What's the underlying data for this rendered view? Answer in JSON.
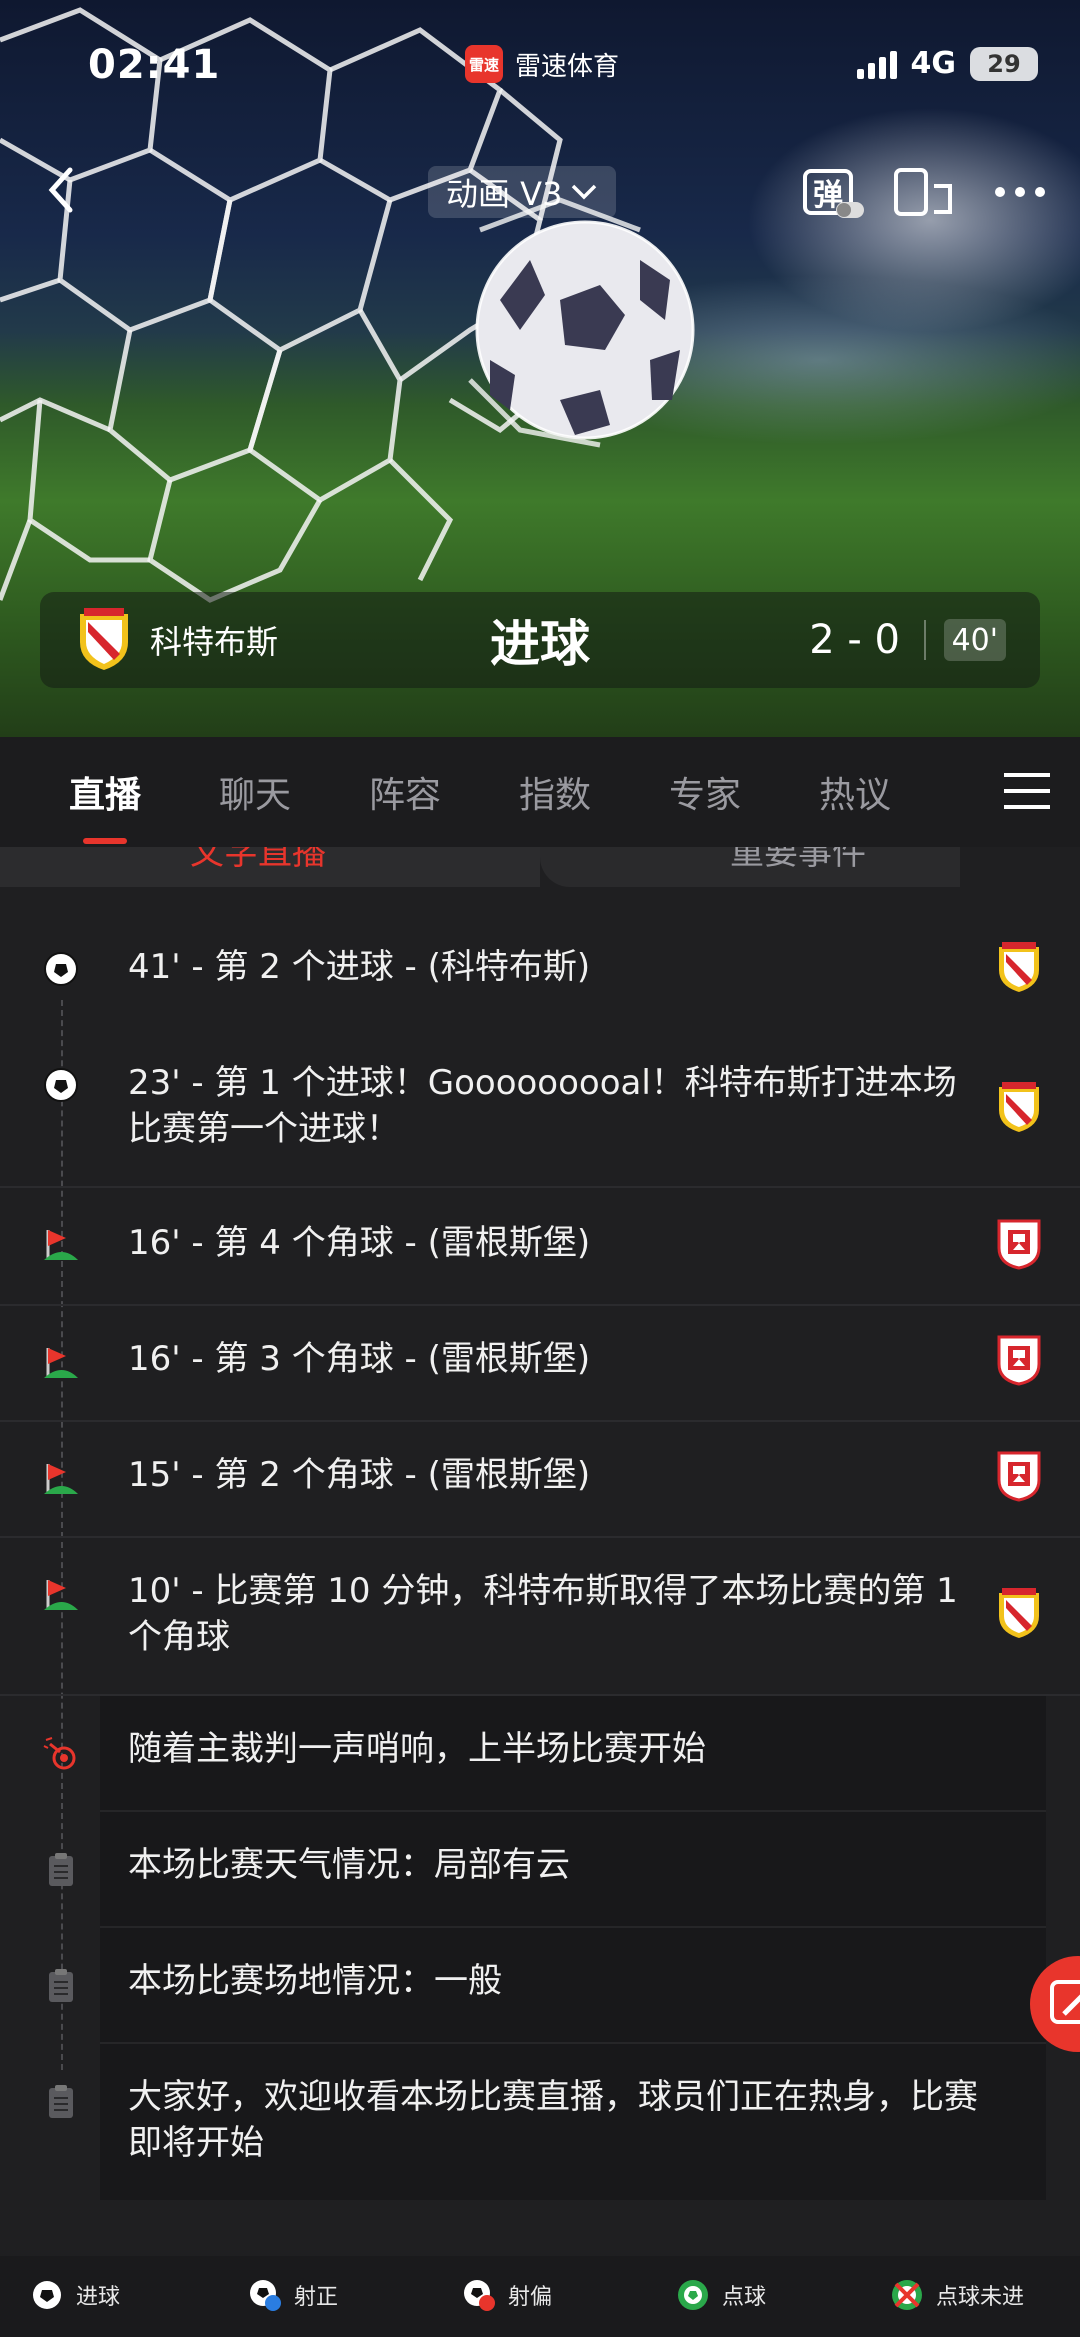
{
  "status_bar": {
    "time": "02:41",
    "app_name": "雷速体育",
    "app_logo_text": "雷速",
    "network": "4G",
    "battery": "29"
  },
  "header": {
    "animation_mode": "动画 V3",
    "danmaku_label": "弹"
  },
  "scoreboard": {
    "team": "科特布斯",
    "event": "进球",
    "score": "2 - 0",
    "minute": "40'"
  },
  "tabs": [
    {
      "label": "直播",
      "active": true
    },
    {
      "label": "聊天"
    },
    {
      "label": "阵容"
    },
    {
      "label": "指数"
    },
    {
      "label": "专家"
    },
    {
      "label": "热议"
    }
  ],
  "subtabs": {
    "left": "文字直播",
    "right": "重要事件"
  },
  "feed": [
    {
      "text": "41' - 第 2 个进球 - (科特布斯)",
      "icon": "soccer-ball-icon",
      "team": "cottbus"
    },
    {
      "text": "23' - 第 1 个进球！Gooooooooal！科特布斯打进本场比赛第一个进球！",
      "icon": "soccer-ball-icon",
      "team": "cottbus"
    },
    {
      "text": "16' - 第 4 个角球 - (雷根斯堡)",
      "icon": "corner-flag-icon",
      "team": "regensburg"
    },
    {
      "text": "16' - 第 3 个角球 - (雷根斯堡)",
      "icon": "corner-flag-icon",
      "team": "regensburg"
    },
    {
      "text": "15' - 第 2 个角球 - (雷根斯堡)",
      "icon": "corner-flag-icon",
      "team": "regensburg"
    },
    {
      "text": "10' - 比赛第 10 分钟，科特布斯取得了本场比赛的第 1 个角球",
      "icon": "corner-flag-icon",
      "team": "cottbus"
    },
    {
      "text": "随着主裁判一声哨响，上半场比赛开始",
      "icon": "whistle-icon"
    },
    {
      "text": "本场比赛天气情况：局部有云",
      "icon": "clipboard-icon"
    },
    {
      "text": "本场比赛场地情况：一般",
      "icon": "clipboard-icon"
    },
    {
      "text": "大家好，欢迎收看本场比赛直播，球员们正在热身，比赛即将开始",
      "icon": "clipboard-icon"
    }
  ],
  "legend": [
    {
      "label": "进球",
      "icon": "goal-icon"
    },
    {
      "label": "射正",
      "icon": "shot-on-target-icon"
    },
    {
      "label": "射偏",
      "icon": "shot-off-target-icon"
    },
    {
      "label": "点球",
      "icon": "penalty-icon"
    },
    {
      "label": "点球未进",
      "icon": "penalty-missed-icon"
    }
  ],
  "colors": {
    "accent": "#e8352c",
    "background": "#1f1f21",
    "cottbus_red": "#d7262d",
    "cottbus_yellow": "#f2c21b"
  }
}
